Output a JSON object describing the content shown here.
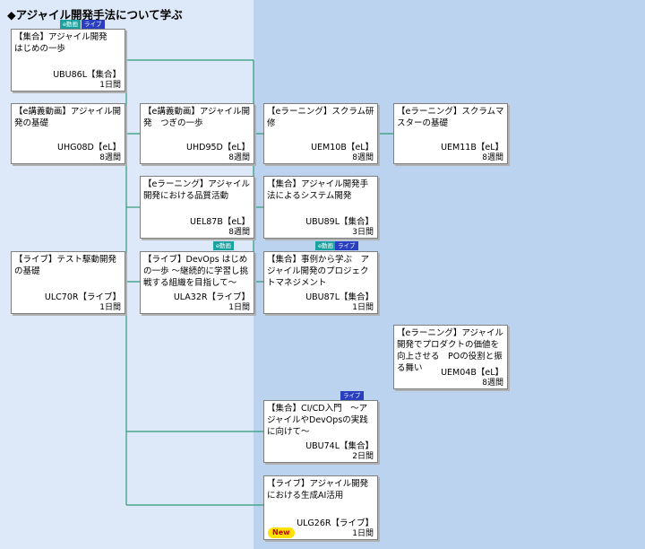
{
  "title": "◆アジャイル開発手法について学ぶ",
  "colors": {
    "left_bg": "#dde9f8",
    "right_bg": "#bcd3ef",
    "line": "#2e9b78"
  },
  "cards": {
    "c1": {
      "title": "【集合】アジャイル開発　はじめの一歩",
      "code": "UBU86L【集合】",
      "duration": "1日間"
    },
    "c2": {
      "title": "【e講義動画】アジャイル開発の基礎",
      "code": "UHG08D【eL】",
      "duration": "8週間"
    },
    "c3": {
      "title": "【ライブ】テスト駆動開発の基礎",
      "code": "ULC70R【ライブ】",
      "duration": "1日間"
    },
    "c4": {
      "title": "【e講義動画】アジャイル開発　つぎの一歩",
      "code": "UHD95D【eL】",
      "duration": "8週間"
    },
    "c5": {
      "title": "【eラーニング】アジャイル開発における品質活動",
      "code": "UEL87B【eL】",
      "duration": "8週間"
    },
    "c6": {
      "title": "【ライブ】DevOps はじめの一歩 ～継続的に学習し挑戦する組織を目指して～",
      "code": "ULA32R【ライブ】",
      "duration": "1日間"
    },
    "c7": {
      "title": "【eラーニング】スクラム研修",
      "code": "UEM10B【eL】",
      "duration": "8週間"
    },
    "c8": {
      "title": "【集合】アジャイル開発手法によるシステム開発",
      "code": "UBU89L【集合】",
      "duration": "3日間"
    },
    "c9": {
      "title": "【集合】事例から学ぶ　アジャイル開発のプロジェクトマネジメント",
      "code": "UBU87L【集合】",
      "duration": "1日間"
    },
    "c10": {
      "title": "【eラーニング】スクラムマスターの基礎",
      "code": "UEM11B【eL】",
      "duration": "8週間"
    },
    "c11": {
      "title": "【eラーニング】アジャイル開発でプロダクトの価値を向上させる　POの役割と振る舞い",
      "code": "UEM04B【eL】",
      "duration": "8週間"
    },
    "c12": {
      "title": "【集合】CI/CD入門　～アジャイルやDevOpsの実践に向けて～",
      "code": "UBU74L【集合】",
      "duration": "2日間"
    },
    "c13": {
      "title": "【ライブ】アジャイル開発における生成AI活用",
      "code": "ULG26R【ライブ】",
      "duration": "1日間",
      "new_label": "New"
    }
  },
  "badges": {
    "edouga": "e動画",
    "live": "ライブ"
  }
}
